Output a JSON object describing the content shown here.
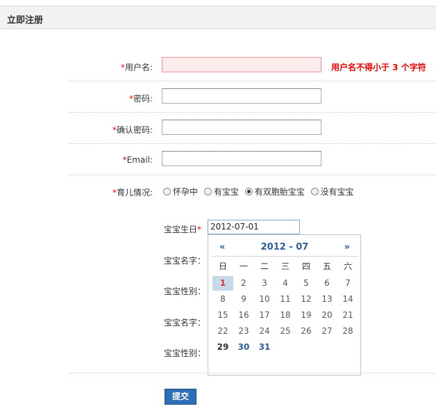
{
  "header": {
    "title": "立即注册"
  },
  "form": {
    "username": {
      "label": "用户名:",
      "value": "",
      "error": "用户名不得小于 3 个字符"
    },
    "password": {
      "label": "密码:",
      "value": ""
    },
    "confirm_password": {
      "label": "确认密码:",
      "value": ""
    },
    "email": {
      "label": "Email:",
      "value": ""
    },
    "parenting": {
      "label": "育儿情况:",
      "options": [
        "怀孕中",
        "有宝宝",
        "有双胞胎宝宝",
        "没有宝宝"
      ],
      "selected": "有双胞胎宝宝"
    },
    "baby_birthday": {
      "label": "宝宝生日",
      "value": "2012-07-01"
    },
    "baby1_name_label": "宝宝名字：",
    "baby1_gender_label": "宝宝性别：",
    "baby2_name_label": "宝宝名字：",
    "baby2_gender_label": "宝宝性别：",
    "submit_label": "提交",
    "required_mark": "*"
  },
  "calendar": {
    "prev": "«",
    "next": "»",
    "year_month": "2012 - 07",
    "weekdays": [
      "日",
      "一",
      "二",
      "三",
      "四",
      "五",
      "六"
    ],
    "weeks": [
      [
        "1",
        "2",
        "3",
        "4",
        "5",
        "6",
        "7"
      ],
      [
        "8",
        "9",
        "10",
        "11",
        "12",
        "13",
        "14"
      ],
      [
        "15",
        "16",
        "17",
        "18",
        "19",
        "20",
        "21"
      ],
      [
        "22",
        "23",
        "24",
        "25",
        "26",
        "27",
        "28"
      ],
      [
        "29",
        "30",
        "31"
      ]
    ],
    "selected_day": "1",
    "colors": {
      "accent": "#2a5d9a",
      "selected_bg": "#c6d9ea",
      "error": "#e00000"
    }
  }
}
